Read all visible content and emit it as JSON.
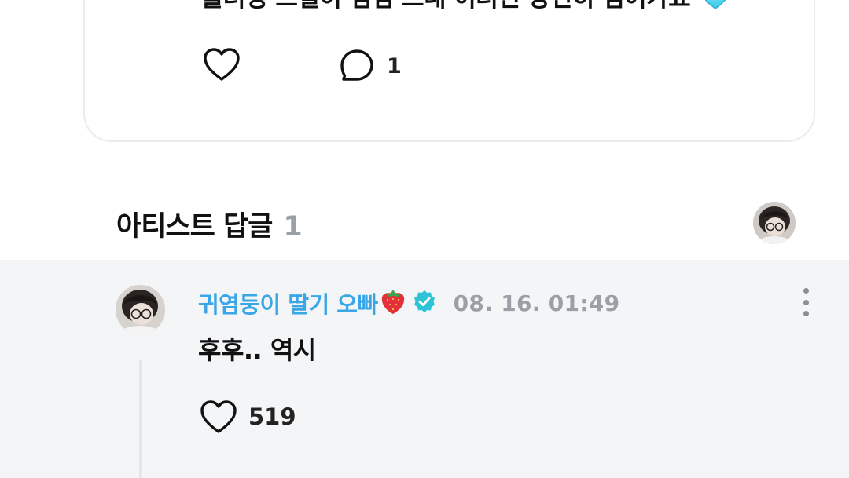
{
  "post": {
    "text": "플러팅 스킬이 점점 느네 이러면 당연히 넘어가죠",
    "reply_count": "1"
  },
  "artist_replies": {
    "title": "아티스트 답글",
    "count": "1"
  },
  "reply": {
    "author": "귀염둥이 딸기 오빠",
    "timestamp": "08. 16. 01:49",
    "text": "후후.. 역시",
    "like_count": "519"
  },
  "colors": {
    "author_name": "#3aa6e6",
    "verified_badge": "#2ec4d6",
    "muted": "#9aa0a6",
    "reply_background": "#f4f5f7",
    "card_border": "#e9ecef"
  },
  "icons": {
    "post_avatar": "default-avatar-icon",
    "like": "heart-outline-icon",
    "reply": "speech-bubble-icon",
    "emoji_after_text": "light-blue-heart-emoji",
    "strawberry": "strawberry-emoji",
    "verified": "verified-badge-icon",
    "more": "more-vertical-icon"
  }
}
